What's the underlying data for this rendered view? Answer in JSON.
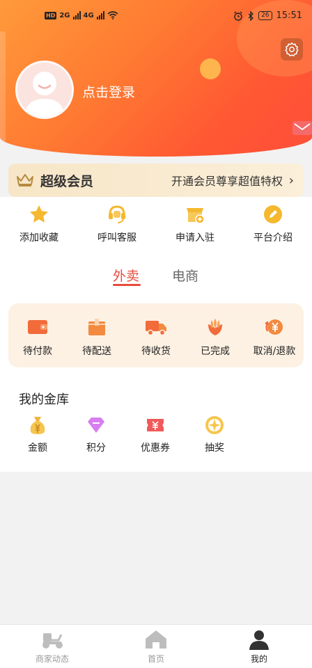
{
  "status_bar": {
    "hd": "HD",
    "net1": "2G",
    "net2": "4G",
    "battery": "26",
    "time": "15:51"
  },
  "profile": {
    "login_label": "点击登录"
  },
  "vip": {
    "title": "超级会员",
    "promo": "开通会员尊享超值特权",
    "arrow": "›"
  },
  "quick_actions": [
    {
      "label": "添加收藏",
      "icon": "star-icon"
    },
    {
      "label": "呼叫客服",
      "icon": "headset-icon"
    },
    {
      "label": "申请入驻",
      "icon": "store-icon"
    },
    {
      "label": "平台介绍",
      "icon": "pencil-icon"
    }
  ],
  "tabs": [
    {
      "label": "外卖",
      "active": true
    },
    {
      "label": "电商",
      "active": false
    }
  ],
  "orders": [
    {
      "label": "待付款",
      "icon": "wallet-icon"
    },
    {
      "label": "待配送",
      "icon": "box-icon"
    },
    {
      "label": "待收货",
      "icon": "truck-icon"
    },
    {
      "label": "已完成",
      "icon": "flower-icon"
    },
    {
      "label": "取消/退款",
      "icon": "refund-icon"
    }
  ],
  "vault": {
    "title": "我的金库",
    "items": [
      {
        "label": "金额",
        "icon": "money-bag-icon"
      },
      {
        "label": "积分",
        "icon": "diamond-icon"
      },
      {
        "label": "优惠券",
        "icon": "coupon-icon"
      },
      {
        "label": "抽奖",
        "icon": "wheel-icon"
      }
    ]
  },
  "bottom_nav": [
    {
      "label": "商家动态",
      "icon": "scooter-icon",
      "active": false
    },
    {
      "label": "首页",
      "icon": "home-icon",
      "active": false
    },
    {
      "label": "我的",
      "icon": "person-icon",
      "active": true
    }
  ],
  "colors": {
    "accent": "#e84b3c",
    "header_start": "#ff9a3a",
    "header_end": "#ff4e3a",
    "vip_bg": "#f7e6c7",
    "orders_bg": "#fdf1e3"
  }
}
